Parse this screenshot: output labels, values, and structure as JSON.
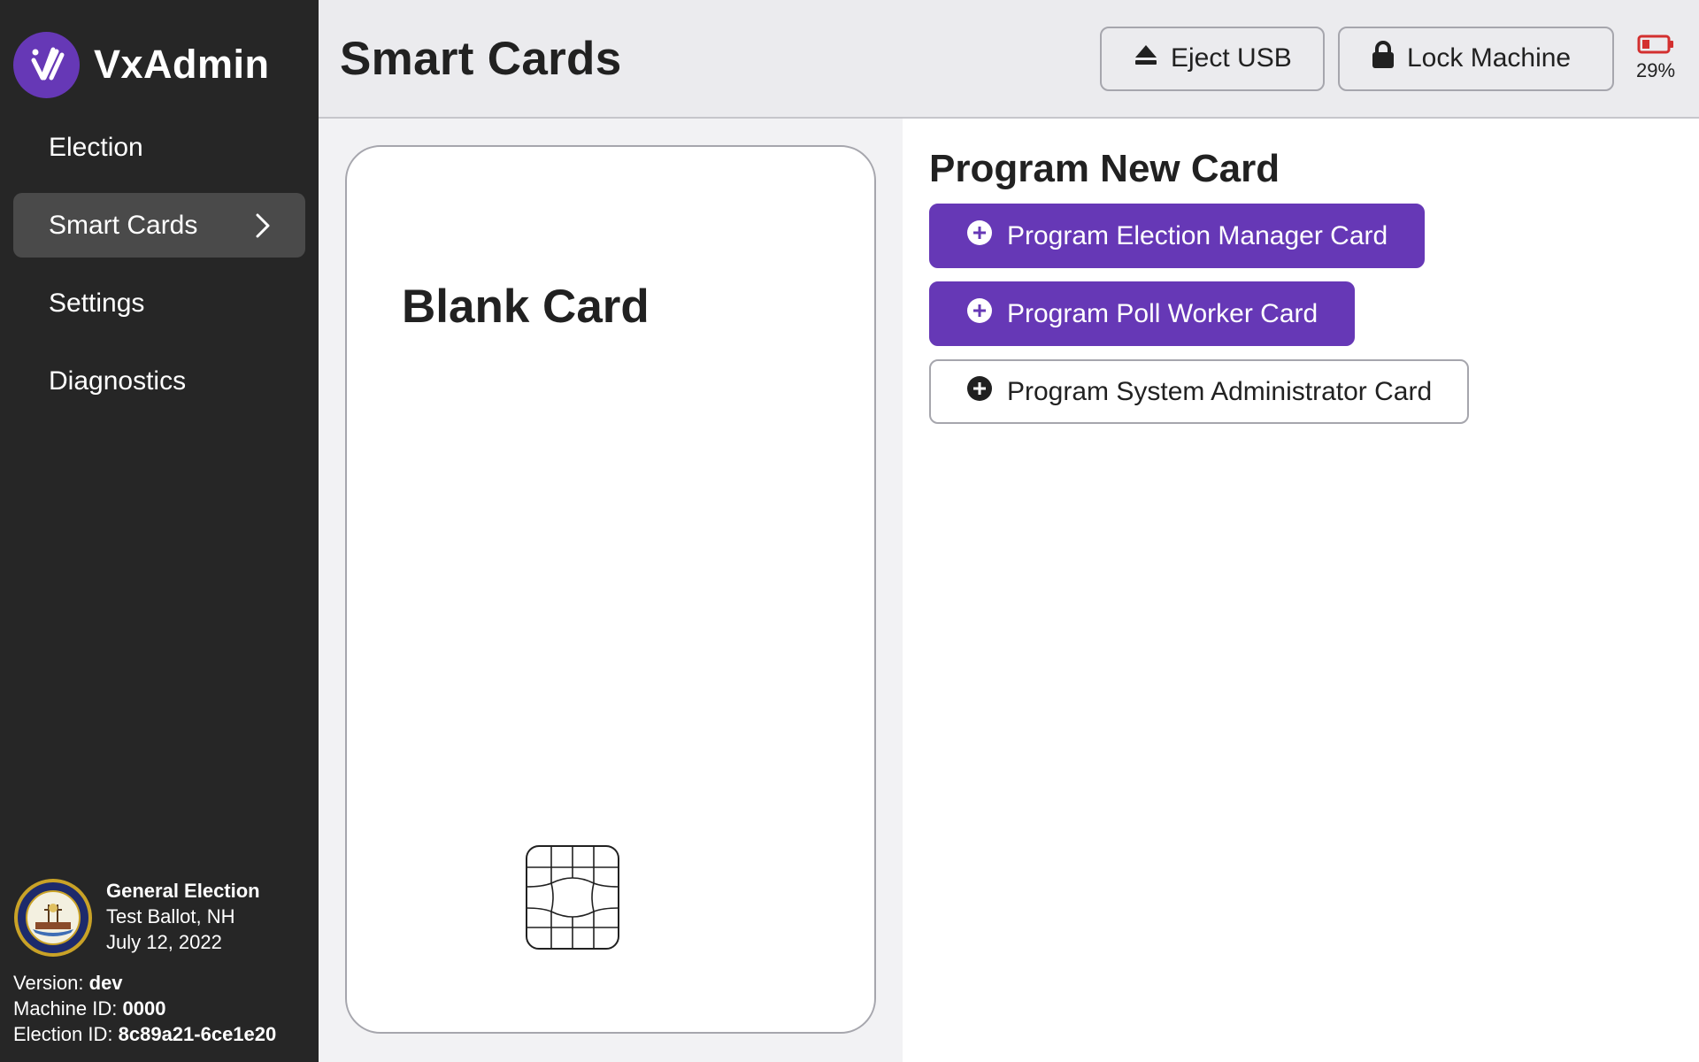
{
  "app": {
    "name": "VxAdmin",
    "brand_color": "#6638b6"
  },
  "sidebar": {
    "items": [
      {
        "label": "Election",
        "active": false
      },
      {
        "label": "Smart Cards",
        "active": true
      },
      {
        "label": "Settings",
        "active": false
      },
      {
        "label": "Diagnostics",
        "active": false
      }
    ],
    "election": {
      "title": "General Election",
      "location": "Test Ballot, NH",
      "date": "July 12, 2022"
    },
    "machine": {
      "version_label": "Version:",
      "version": "dev",
      "machine_id_label": "Machine ID:",
      "machine_id": "0000",
      "election_id_label": "Election ID:",
      "election_id": "8c89a21-6ce1e20"
    }
  },
  "header": {
    "title": "Smart Cards",
    "eject_label": "Eject USB",
    "lock_label": "Lock Machine",
    "battery_percent": "29%",
    "battery_level": 0.29,
    "battery_color": "#d32f2f"
  },
  "card": {
    "title": "Blank Card"
  },
  "program": {
    "title": "Program New Card",
    "buttons": [
      {
        "label": "Program Election Manager Card",
        "style": "primary"
      },
      {
        "label": "Program Poll Worker Card",
        "style": "primary"
      },
      {
        "label": "Program System Administrator Card",
        "style": "secondary"
      }
    ]
  },
  "icons": {
    "logo": "vx-logo-icon",
    "chevron": "chevron-right-icon",
    "eject": "eject-icon",
    "lock": "lock-icon",
    "battery": "battery-low-icon",
    "plus": "plus-circle-icon",
    "chip": "card-chip-icon",
    "seal": "state-seal-icon"
  }
}
